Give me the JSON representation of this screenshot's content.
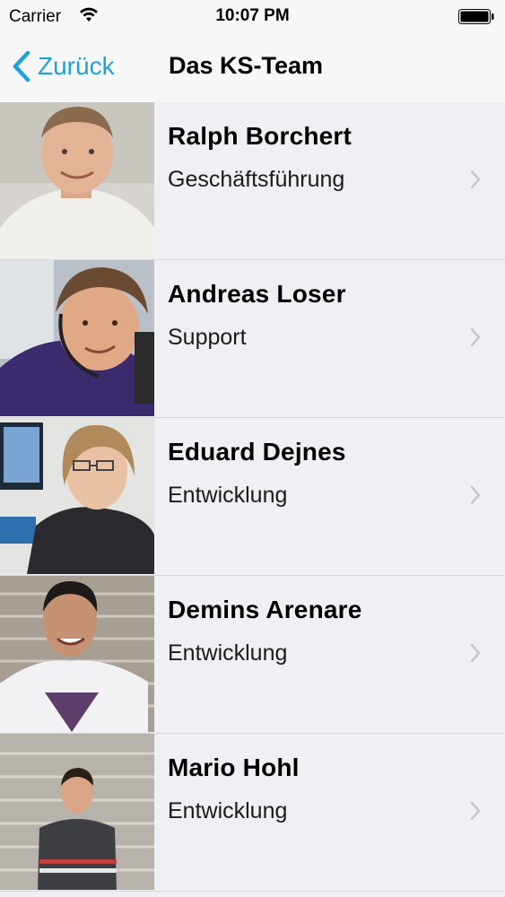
{
  "status_bar": {
    "carrier": "Carrier",
    "time": "10:07 PM",
    "wifi_icon": "wifi-icon",
    "battery_icon": "battery-icon"
  },
  "nav": {
    "back_label": "Zurück",
    "back_icon": "chevron-left-icon",
    "title": "Das KS-Team",
    "accent_color": "#1fa2d8"
  },
  "team": [
    {
      "name": "Ralph Borchert",
      "role": "Geschäftsführung"
    },
    {
      "name": "Andreas Loser",
      "role": "Support"
    },
    {
      "name": "Eduard Dejnes",
      "role": "Entwicklung"
    },
    {
      "name": "Demins Arenare",
      "role": "Entwicklung"
    },
    {
      "name": "Mario Hohl",
      "role": "Entwicklung"
    }
  ]
}
